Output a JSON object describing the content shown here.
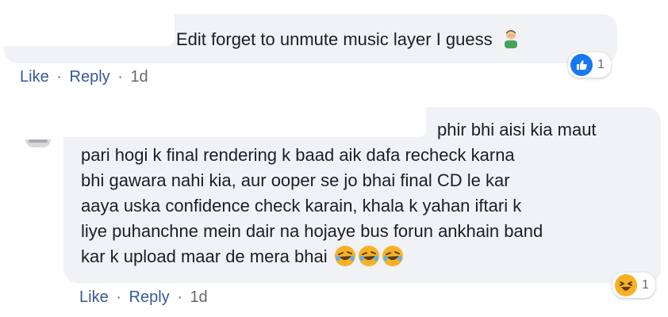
{
  "comment1": {
    "text": "Edit forget to unmute music layer I guess",
    "emoji": "facepalm-man-icon",
    "reaction": {
      "type": "like",
      "count": "1"
    },
    "actions": {
      "like": "Like",
      "reply": "Reply",
      "sep": "·",
      "time": "1d"
    }
  },
  "comment2": {
    "line1": "phir bhi aisi kia maut",
    "lines": [
      "pari hogi k final rendering k baad aik dafa recheck karna",
      "bhi gawara nahi kia, aur ooper se jo bhai final CD le kar",
      "aaya uska confidence check karain, khala k yahan iftari k",
      "liye puhanchne mein dair na hojaye bus forun ankhain band",
      "kar k upload maar de mera bhai"
    ],
    "emojis": [
      "rolling-laughing-icon",
      "rolling-laughing-icon",
      "rolling-laughing-icon"
    ],
    "reaction": {
      "type": "haha",
      "count": "1"
    },
    "actions": {
      "like": "Like",
      "reply": "Reply",
      "sep": "·",
      "time": "1d"
    }
  },
  "colors": {
    "bubble": "#f0f2f5",
    "link": "#385898",
    "meta": "#65676b",
    "like_blue": "#1877f2",
    "haha_yellow": "#f7b125"
  }
}
